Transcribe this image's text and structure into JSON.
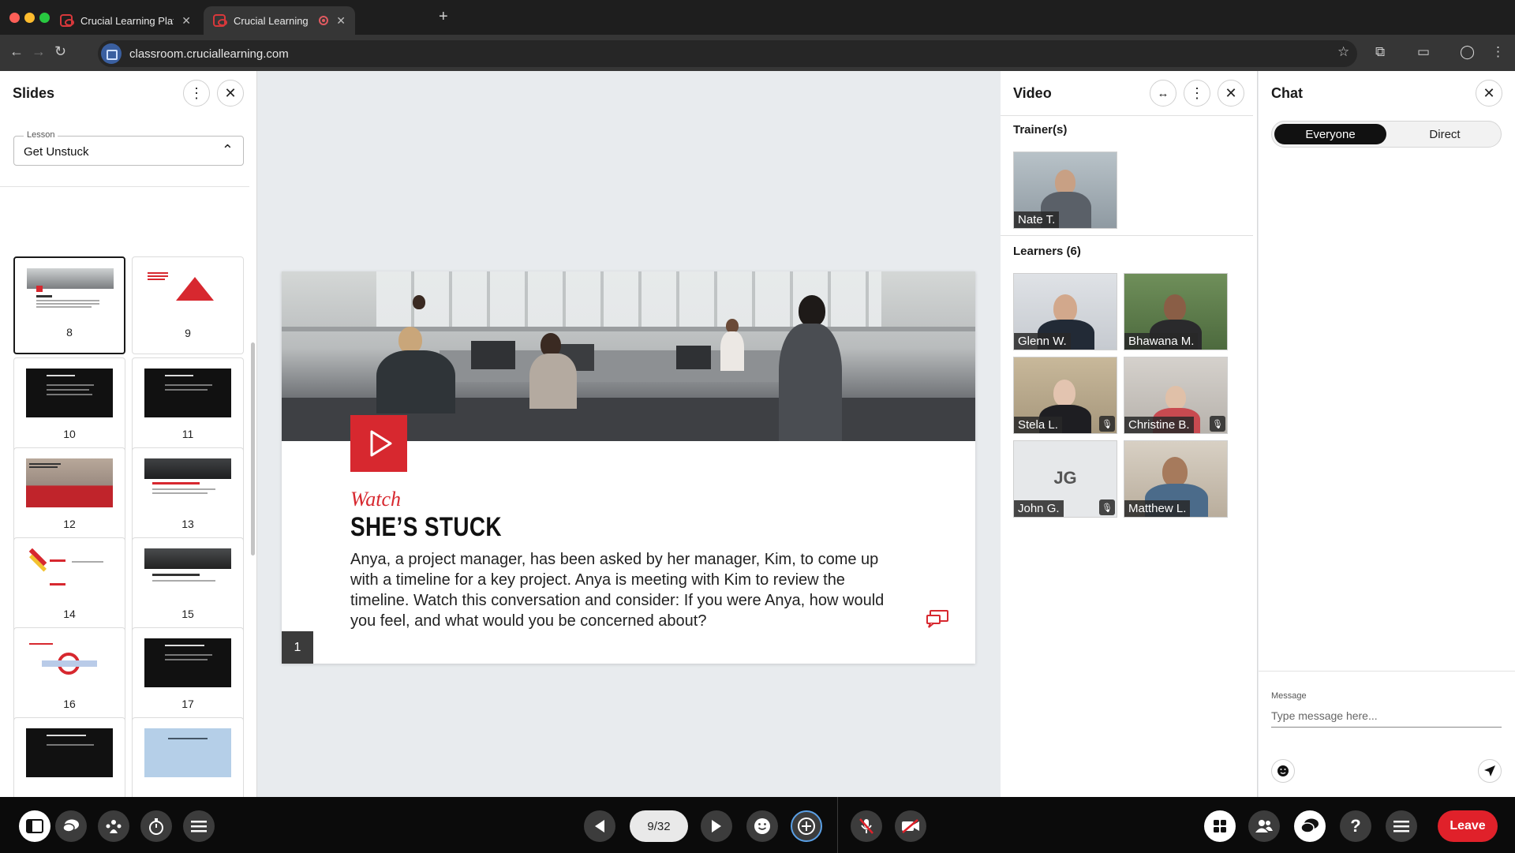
{
  "browser": {
    "tabs": [
      {
        "title": "Crucial Learning Platform: Ev"
      },
      {
        "title": "Crucial Learning"
      }
    ],
    "url": "classroom.cruciallearning.com"
  },
  "slides_panel": {
    "title": "Slides",
    "lesson_label": "Lesson",
    "lesson_value": "Get Unstuck",
    "thumbnails": [
      {
        "num": "8"
      },
      {
        "num": "9"
      },
      {
        "num": "10"
      },
      {
        "num": "11"
      },
      {
        "num": "12"
      },
      {
        "num": "13"
      },
      {
        "num": "14"
      },
      {
        "num": "15"
      },
      {
        "num": "16"
      },
      {
        "num": "17"
      }
    ]
  },
  "slide": {
    "eyebrow": "Watch",
    "title": "SHE’S STUCK",
    "body": "Anya, a project manager, has been asked by her manager, Kim, to come up with a timeline for a key project. Anya is meeting with Kim to review the timeline. Watch this conversation and consider: If you were Anya, how would you feel, and what would you be concerned about?",
    "number": "1"
  },
  "video_panel": {
    "title": "Video",
    "trainers_label": "Trainer(s)",
    "trainers": [
      {
        "name": "Nate T."
      }
    ],
    "learners_label": "Learners (6)",
    "learners": [
      {
        "name": "Glenn W."
      },
      {
        "name": "Bhawana M."
      },
      {
        "name": "Stela L."
      },
      {
        "name": "Christine B."
      },
      {
        "name": "John G.",
        "initials": "JG"
      },
      {
        "name": "Matthew L."
      }
    ]
  },
  "chat_panel": {
    "title": "Chat",
    "tab_everyone": "Everyone",
    "tab_direct": "Direct",
    "message_label": "Message",
    "message_placeholder": "Type message here..."
  },
  "bottom_bar": {
    "pager": "9/32",
    "leave_label": "Leave"
  },
  "colors": {
    "brand_red": "#d7282f",
    "leave_red": "#e0212a"
  }
}
